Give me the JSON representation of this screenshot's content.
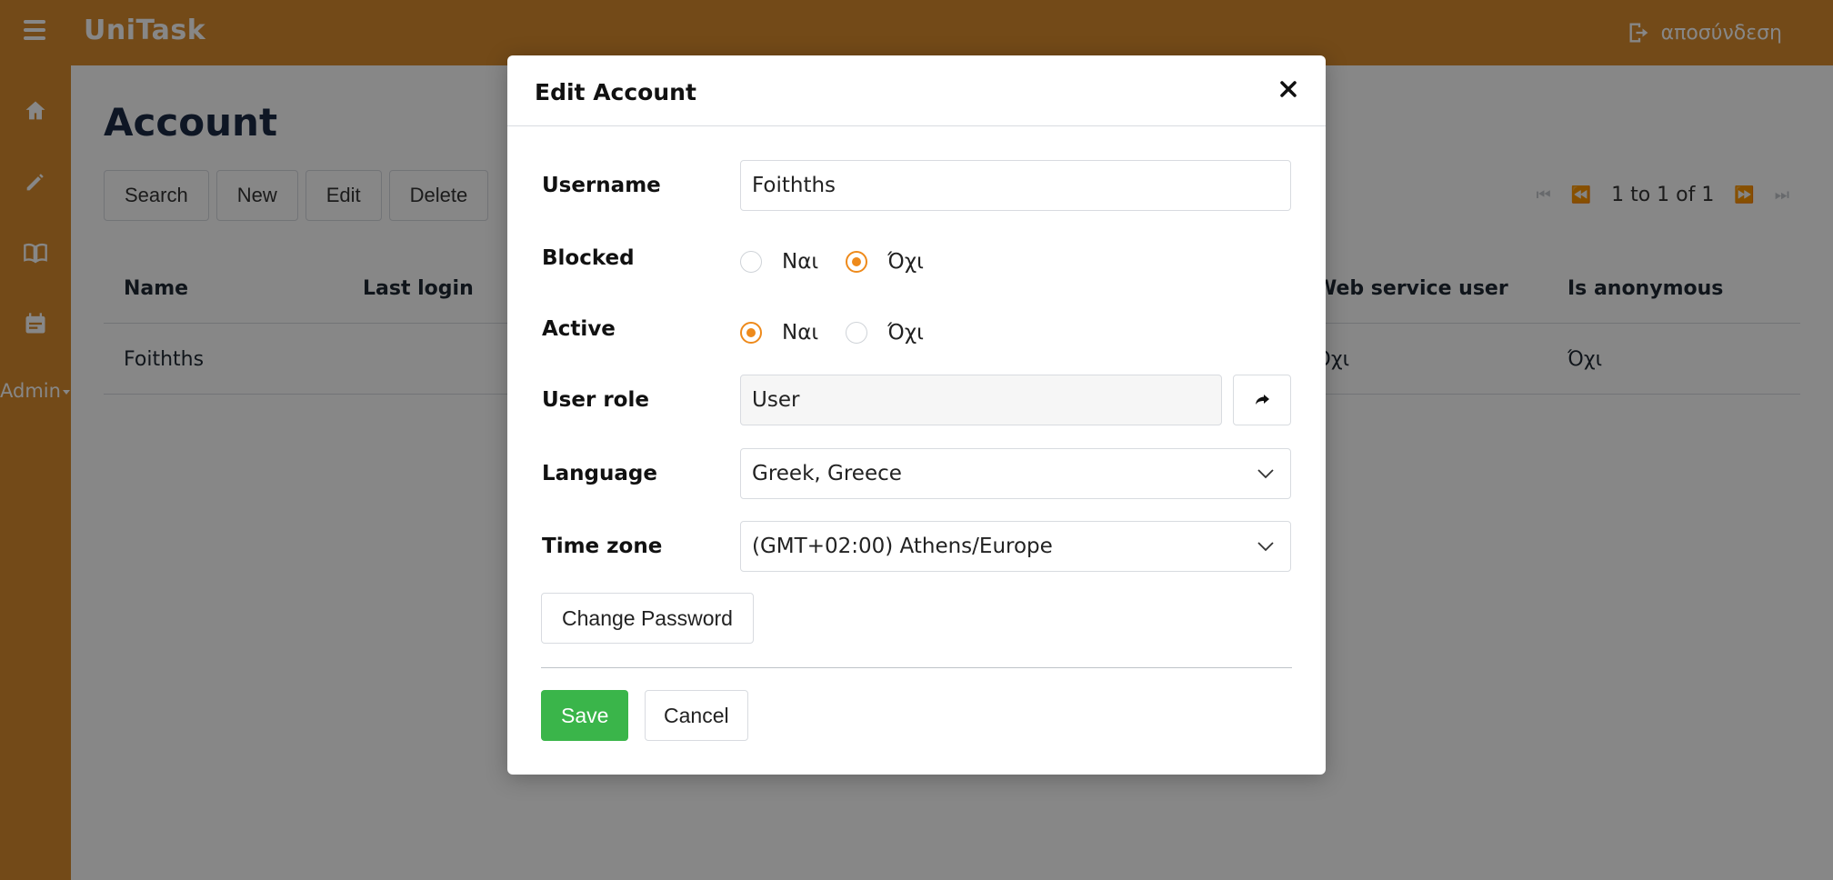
{
  "app": {
    "brand": "UniTask",
    "logout_label": "αποσύνδεση",
    "accent_color": "#d98d2e"
  },
  "sidebar": {
    "items": [
      {
        "icon": "home-icon"
      },
      {
        "icon": "pencil-icon"
      },
      {
        "icon": "book-icon"
      },
      {
        "icon": "calendar-icon"
      }
    ],
    "admin_label": "Admin"
  },
  "page": {
    "title": "Account",
    "toolbar": {
      "search": "Search",
      "new": "New",
      "edit": "Edit",
      "delete": "Delete"
    },
    "pager": {
      "summary": "1 to 1 of 1"
    },
    "table": {
      "columns": [
        "Name",
        "Last login",
        "Web service user",
        "Is anonymous"
      ],
      "rows": [
        {
          "name": "Foithths",
          "last_login": "",
          "web_service_user": "Όχι",
          "is_anonymous": "Όχι"
        }
      ]
    }
  },
  "modal": {
    "title": "Edit Account",
    "fields": {
      "username": {
        "label": "Username",
        "value": "Foithths"
      },
      "blocked": {
        "label": "Blocked",
        "options": [
          "Ναι",
          "Όχι"
        ],
        "selected": "Όχι"
      },
      "active": {
        "label": "Active",
        "options": [
          "Ναι",
          "Όχι"
        ],
        "selected": "Ναι"
      },
      "user_role": {
        "label": "User role",
        "value": "User"
      },
      "language": {
        "label": "Language",
        "value": "Greek, Greece"
      },
      "time_zone": {
        "label": "Time zone",
        "value": "(GMT+02:00) Athens/Europe"
      }
    },
    "change_password_label": "Change Password",
    "save_label": "Save",
    "cancel_label": "Cancel",
    "save_color": "#3ab54a",
    "radio_color": "#ee8a1b"
  }
}
